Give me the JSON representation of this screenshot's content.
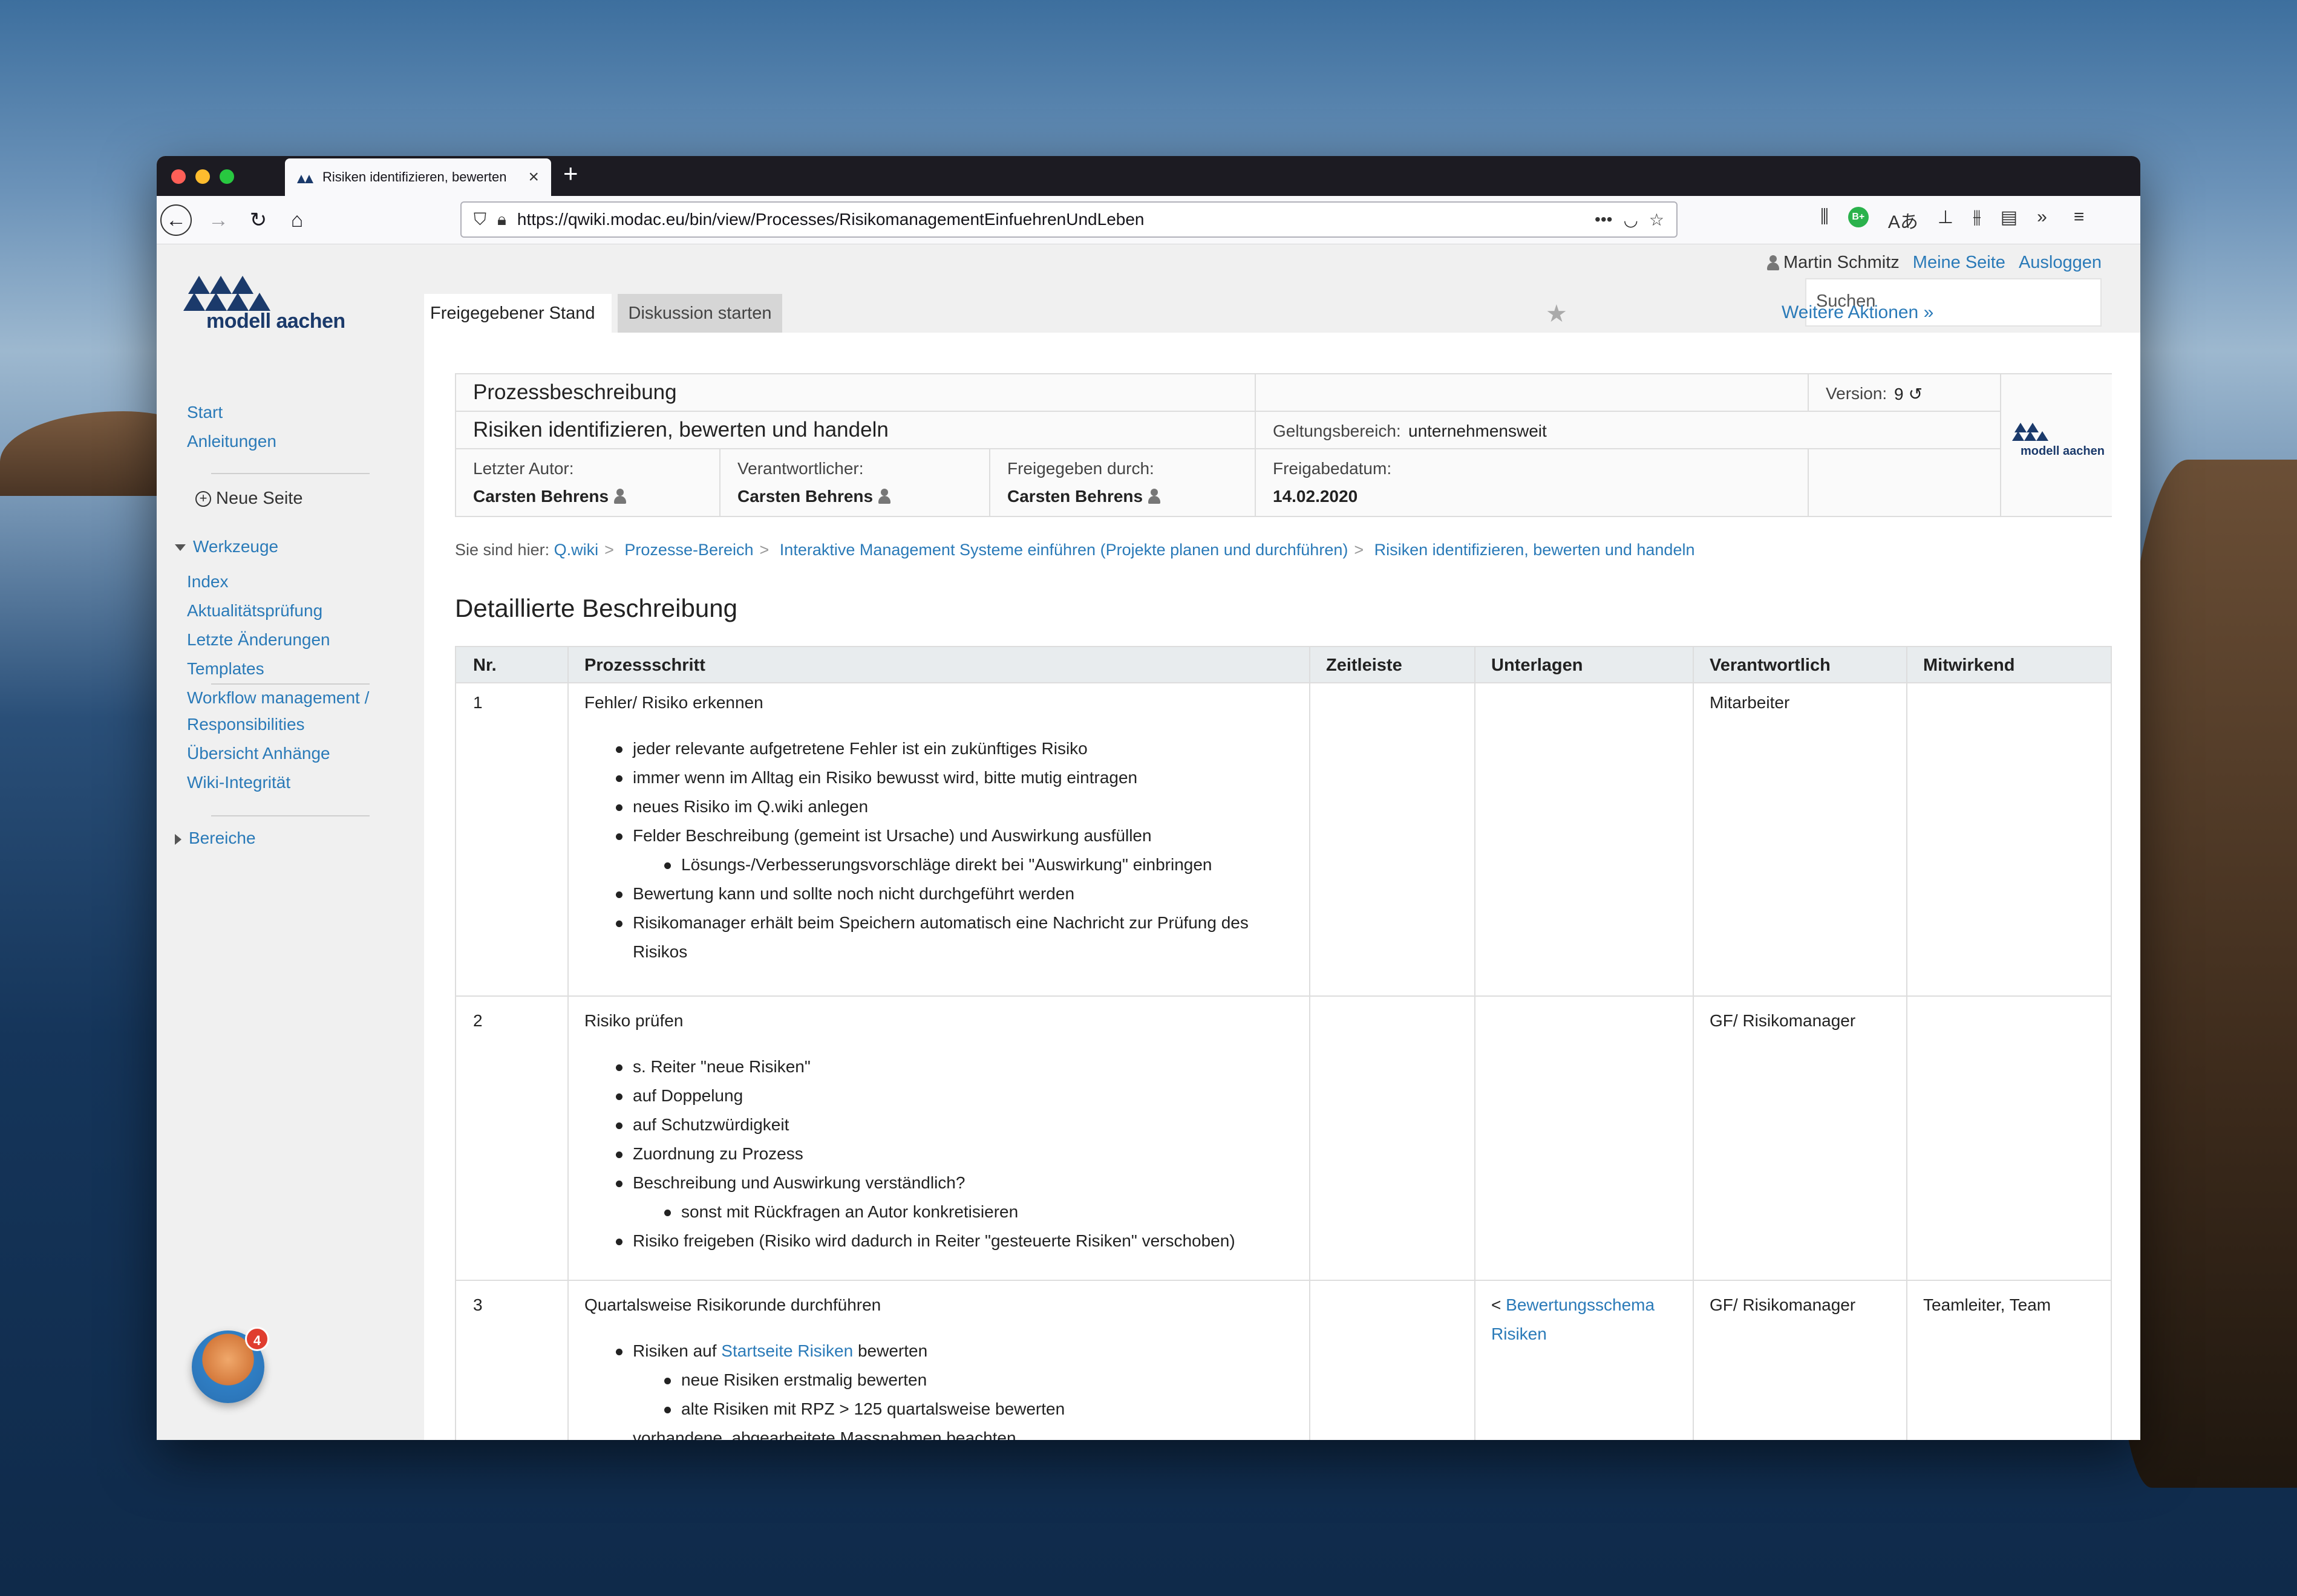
{
  "browser": {
    "tab_title": "Risiken identifizieren, bewerten",
    "url": "https://qwiki.modac.eu/bin/view/Processes/RisikomanagementEinfuehrenUndLeben",
    "new_tab": "+",
    "green_icon": "B+"
  },
  "logo": {
    "text": "modell aachen"
  },
  "user": {
    "name": "Martin Schmitz",
    "my_page": "Meine Seite",
    "logout": "Ausloggen"
  },
  "search": {
    "placeholder": "Suchen"
  },
  "tabs": {
    "active": "Freigegebener Stand",
    "inactive": "Diskussion starten"
  },
  "more_actions": "Weitere Aktionen »",
  "sidebar": {
    "start": "Start",
    "anleitungen": "Anleitungen",
    "neue_seite": "Neue Seite",
    "werkzeuge": "Werkzeuge",
    "tools": [
      "Index",
      "Aktualitätsprüfung",
      "Letzte Änderungen",
      "Templates",
      "Workflow management /",
      "Responsibilities",
      "Übersicht Anhänge",
      "Wiki-Integrität"
    ],
    "bereiche": "Bereiche",
    "mascot_badge": "4"
  },
  "header": {
    "doc_type": "Prozessbeschreibung",
    "title": "Risiken identifizieren, bewerten und handeln",
    "version_label": "Version:",
    "version": "9",
    "scope_label": "Geltungsbereich:",
    "scope": "unternehmensweit",
    "author_label": "Letzter Autor:",
    "author": "Carsten Behrens",
    "responsible_label": "Verantwortlicher:",
    "responsible": "Carsten Behrens",
    "approved_label": "Freigegeben durch:",
    "approved": "Carsten Behrens",
    "date_label": "Freigabedatum:",
    "date": "14.02.2020"
  },
  "breadcrumb": {
    "prefix": "Sie sind hier:",
    "items": [
      "Q.wiki",
      "Prozesse-Bereich",
      "Interaktive Management Systeme einführen (Projekte planen und durchführen)",
      "Risiken identifizieren, bewerten und handeln"
    ]
  },
  "section_title": "Detaillierte Beschreibung",
  "table": {
    "columns": [
      "Nr.",
      "Prozessschritt",
      "Zeitleiste",
      "Unterlagen",
      "Verantwortlich",
      "Mitwirkend"
    ],
    "rows": [
      {
        "nr": "1",
        "step": "Fehler/ Risiko erkennen",
        "bullets": [
          "jeder relevante aufgetretene Fehler ist ein zukünftiges Risiko",
          "immer wenn im Alltag ein Risiko bewusst wird, bitte mutig eintragen",
          "neues Risiko im Q.wiki anlegen",
          "Felder Beschreibung (gemeint ist Ursache) und Auswirkung ausfüllen",
          "Lösungs-/Verbesserungsvorschläge direkt bei \"Auswirkung\" einbringen",
          "Bewertung kann und sollte noch nicht durchgeführt werden",
          "Risikomanager erhält beim Speichern automatisch eine Nachricht zur Prüfung des",
          "Risikos"
        ],
        "verantwortlich": "Mitarbeiter"
      },
      {
        "nr": "2",
        "step": "Risiko prüfen",
        "bullets": [
          "s. Reiter \"neue Risiken\"",
          "auf Doppelung",
          "auf Schutzwürdigkeit",
          "Zuordnung zu Prozess",
          "Beschreibung und Auswirkung verständlich?",
          "sonst mit Rückfragen an Autor konkretisieren",
          "Risiko freigeben (Risiko wird dadurch in Reiter \"gesteuerte Risiken\" verschoben)"
        ],
        "verantwortlich": "GF/ Risikomanager"
      },
      {
        "nr": "3",
        "step": "Quartalsweise Risikorunde durchführen",
        "bullet_pre": "Risiken auf",
        "bullet_link": "Startseite Risiken",
        "bullet_post": "bewerten",
        "sub1": "neue Risiken erstmalig bewerten",
        "sub2": "alte Risiken mit RPZ > 125 quartalsweise bewerten",
        "cut": "vorhandene, abgearbeitete Massnahmen beachten",
        "unterlagen_prefix": "<",
        "unterlagen_link1": "Bewertungsschema",
        "unterlagen_link2": "Risiken",
        "verantwortlich": "GF/ Risikomanager",
        "mitwirkend": "Teamleiter, Team"
      }
    ]
  }
}
